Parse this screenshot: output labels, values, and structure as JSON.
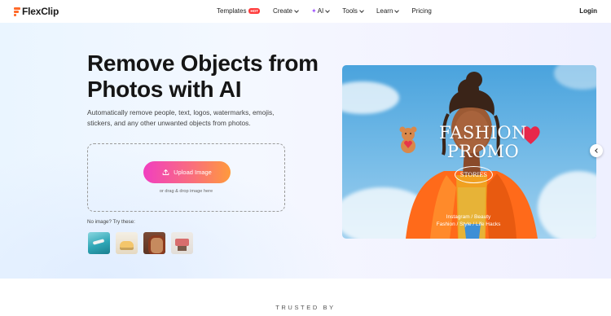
{
  "header": {
    "logo": "FlexClip",
    "nav": [
      {
        "label": "Templates",
        "badge": "HOT",
        "dropdown": false
      },
      {
        "label": "Create",
        "dropdown": true
      },
      {
        "label": "AI",
        "dropdown": true,
        "icon": "sparkle-icon"
      },
      {
        "label": "Tools",
        "dropdown": true
      },
      {
        "label": "Learn",
        "dropdown": true
      },
      {
        "label": "Pricing",
        "dropdown": false
      }
    ],
    "login": "Login"
  },
  "hero": {
    "title": "Remove Objects from Photos with AI",
    "description": "Automatically remove people, text, logos, watermarks, emojis, stickers, and any other unwanted objects from photos.",
    "upload_label": "Upload Image",
    "drop_hint": "or drag & drop image here",
    "try_label": "No image? Try these:"
  },
  "promo": {
    "title_line1": "FASHION",
    "title_line2": "PROMO",
    "stories": "STORIES",
    "sub_line1": "Instagram / Beauty",
    "sub_line2": "Fashion / Style / Life Hacks"
  },
  "trusted": "TRUSTED BY",
  "colors": {
    "accent_start": "#f13fc0",
    "accent_end": "#ff9a3c",
    "hot_badge": "#ff3b3b",
    "logo_mark": "#ff6a2a"
  }
}
